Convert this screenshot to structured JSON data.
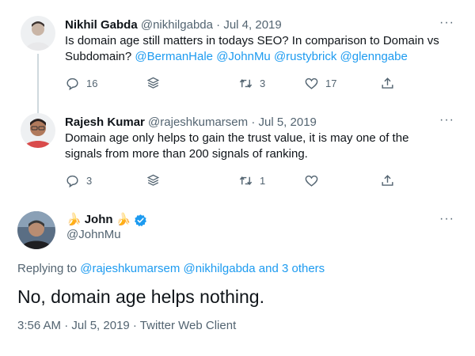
{
  "tweets": [
    {
      "name": "Nikhil Gabda",
      "handle": "@nikhilgabda",
      "separator": "·",
      "date": "Jul 4, 2019",
      "more": "···",
      "text": "Is domain age still matters in todays SEO? In comparison to Domain vs Subdomain?",
      "mentions": [
        "@BermanHale",
        "@JohnMu",
        "@rustybrick",
        "@glenngabe"
      ],
      "actions": {
        "replies": "16",
        "retweets": "3",
        "likes": "17"
      }
    },
    {
      "name": "Rajesh Kumar",
      "handle": "@rajeshkumarsem",
      "separator": "·",
      "date": "Jul 5, 2019",
      "more": "···",
      "text": "Domain age only helps to gain the trust value, it is may one of the signals from more than 200 signals of ranking.",
      "actions": {
        "replies": "3",
        "retweets": "1",
        "likes": ""
      }
    }
  ],
  "main_tweet": {
    "emoji": "🍌",
    "name": "John",
    "handle": "@JohnMu",
    "more": "···",
    "reply_prefix": "Replying to",
    "reply_mentions": "@rajeshkumarsem @nikhilgabda and 3 others",
    "text": "No, domain age helps nothing.",
    "meta": "3:56 AM · Jul 5, 2019 · Twitter Web Client"
  },
  "colors": {
    "accent": "#1d9bf0",
    "muted": "#536471",
    "text": "#0f1419",
    "thread_line": "#cfd9de"
  },
  "icons": [
    "reply-icon",
    "stats-icon",
    "retweet-icon",
    "like-icon",
    "share-icon",
    "verified-icon",
    "banana-emoji"
  ]
}
